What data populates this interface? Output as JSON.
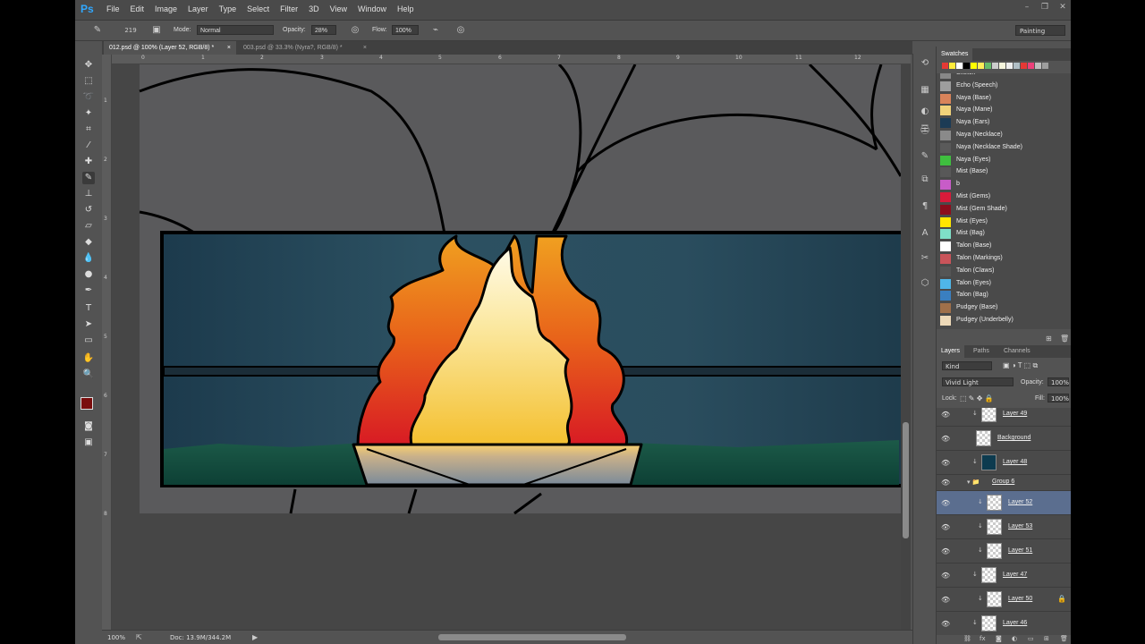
{
  "app": {
    "logo": "Ps",
    "menu": [
      "File",
      "Edit",
      "Image",
      "Layer",
      "Type",
      "Select",
      "Filter",
      "3D",
      "View",
      "Window",
      "Help"
    ],
    "window_controls": [
      "minimize-icon",
      "restore-icon",
      "close-icon"
    ]
  },
  "options": {
    "brush_size": "219",
    "mode_label": "Mode:",
    "mode_value": "Normal",
    "opacity_label": "Opacity:",
    "opacity_value": "28%",
    "flow_label": "Flow:",
    "flow_value": "100%",
    "workspace": "Painting"
  },
  "tabs": [
    {
      "label": "012.psd @ 100% (Layer 52, RGB/8) *",
      "close": "×"
    },
    {
      "label": "003.psd @ 33.3% (Nyra?, RGB/8) *",
      "close": "×"
    }
  ],
  "rulers": {
    "top": [
      "0",
      "1",
      "2",
      "3",
      "4",
      "5",
      "6",
      "7",
      "8",
      "9",
      "10",
      "11",
      "12"
    ],
    "left": [
      "1",
      "2",
      "3",
      "4",
      "5",
      "6",
      "7",
      "8"
    ]
  },
  "status": {
    "zoom": "100%",
    "doc": "Doc: 13.9M/344.2M"
  },
  "colors": {
    "foreground": "#7a0d0d",
    "background": "#e8a020",
    "accent_selected": "#5b6e8f"
  },
  "swatches": {
    "title": "Swatches",
    "row": [
      "#e53935",
      "#ffeb3b",
      "#ffffff",
      "#000000",
      "#ffff00",
      "#ffee58",
      "#66bb6a",
      "#cccccc",
      "#f5f5dc",
      "#eeeeee",
      "#b0bec5",
      "#e53935",
      "#ec407a",
      "#bdbdbd",
      "#9e9e9e"
    ],
    "items": [
      {
        "name": "Sketch",
        "color": "#888888"
      },
      {
        "name": "Echo (Speech)",
        "color": "#9e9e9e"
      },
      {
        "name": "Naya (Base)",
        "color": "#d9835a"
      },
      {
        "name": "Naya (Mane)",
        "color": "#f0d27a"
      },
      {
        "name": "Naya (Ears)",
        "color": "#1c3b55"
      },
      {
        "name": "Naya (Necklace)",
        "color": "#8a8a8a"
      },
      {
        "name": "Naya (Necklace Shade)",
        "color": "#5a5a5a"
      },
      {
        "name": "Naya (Eyes)",
        "color": "#3fbf3f"
      },
      {
        "name": "Mist (Base)",
        "color": "#585858"
      },
      {
        "name": "b",
        "color": "#c85cc8"
      },
      {
        "name": "Mist (Gems)",
        "color": "#d81b3a"
      },
      {
        "name": "Mist (Gem Shade)",
        "color": "#8c0d1c"
      },
      {
        "name": "Mist (Eyes)",
        "color": "#ffe600"
      },
      {
        "name": "Mist (Bag)",
        "color": "#7fe0c8"
      },
      {
        "name": "Talon (Base)",
        "color": "#ffffff"
      },
      {
        "name": "Talon (Markings)",
        "color": "#c9545a"
      },
      {
        "name": "Talon (Claws)",
        "color": "#555555"
      },
      {
        "name": "Talon (Eyes)",
        "color": "#4fb6e8"
      },
      {
        "name": "Talon (Bag)",
        "color": "#3a7fc0"
      },
      {
        "name": "Pudgey (Base)",
        "color": "#a0704a"
      },
      {
        "name": "Pudgey (Underbelly)",
        "color": "#eed9b8"
      }
    ]
  },
  "layers_panel": {
    "tabs": [
      "Layers",
      "Paths",
      "Channels"
    ],
    "kind": "Kind",
    "blend_mode": "Vivid Light",
    "opacity_label": "Opacity:",
    "opacity_value": "100%",
    "lock_label": "Lock:",
    "fill_label": "Fill:",
    "fill_value": "100%",
    "items": [
      {
        "name": "Layer 49",
        "thumb": "check",
        "indent": 1,
        "selected": false
      },
      {
        "name": "Background",
        "thumb": "check",
        "indent": 0,
        "selected": false
      },
      {
        "name": "Layer 48",
        "thumb": "dark",
        "indent": 1,
        "selected": false
      },
      {
        "name": "Group 6",
        "thumb": "folder",
        "indent": 0,
        "selected": false
      },
      {
        "name": "Layer 52",
        "thumb": "check",
        "indent": 2,
        "selected": true
      },
      {
        "name": "Layer 53",
        "thumb": "check",
        "indent": 2,
        "selected": false
      },
      {
        "name": "Layer 51",
        "thumb": "check",
        "indent": 2,
        "selected": false
      },
      {
        "name": "Layer 47",
        "thumb": "check",
        "indent": 1,
        "selected": false
      },
      {
        "name": "Layer 50",
        "thumb": "check",
        "indent": 2,
        "selected": false,
        "locked": true
      },
      {
        "name": "Layer 46",
        "thumb": "check",
        "indent": 1,
        "selected": false
      }
    ]
  }
}
